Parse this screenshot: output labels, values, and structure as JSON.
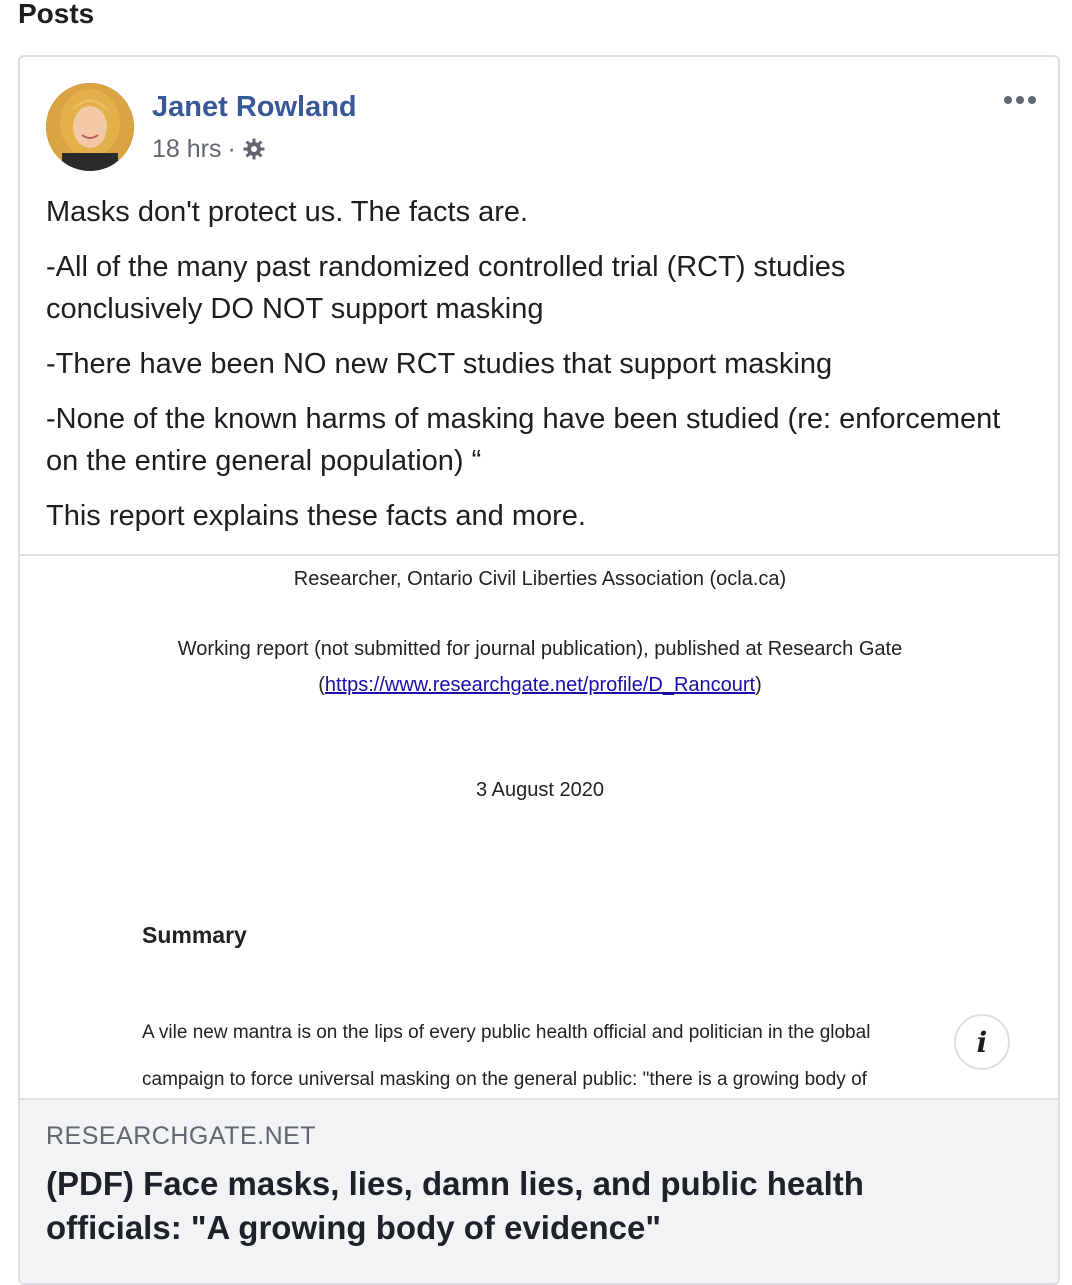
{
  "section_title": "Posts",
  "post": {
    "author": "Janet Rowland",
    "time": "18 hrs",
    "separator": "·",
    "privacy_icon": "gear-icon",
    "paragraphs": [
      "Masks don't protect us. The facts are.",
      "-All of the many past randomized controlled trial (RCT) studies conclusively DO NOT support masking",
      "-There have been NO new RCT studies that support masking",
      "-None of the known harms of masking have been studied (re: enforcement on the entire general population) “",
      "This report explains these facts and more."
    ]
  },
  "preview": {
    "line1": "Researcher, Ontario Civil Liberties Association (ocla.ca)",
    "line2": "Working report (not submitted for journal publication), published at Research Gate",
    "link_open": "(",
    "link_text": "https://www.researchgate.net/profile/D_Rancourt",
    "link_close": ")",
    "date": "3 August 2020",
    "summary_heading": "Summary",
    "body1": "A vile new mantra is on the lips of every public health official and politician in the global",
    "body2": "campaign to force universal masking on the general public: \"there is a growing body of"
  },
  "link_card": {
    "domain": "RESEARCHGATE.NET",
    "title": "(PDF) Face masks, lies, damn lies, and public health officials: \"A growing body of evidence\"",
    "info_glyph": "i"
  },
  "colors": {
    "author_link": "#385898",
    "meta_text": "#606770",
    "link_box_bg": "#f2f3f5"
  }
}
